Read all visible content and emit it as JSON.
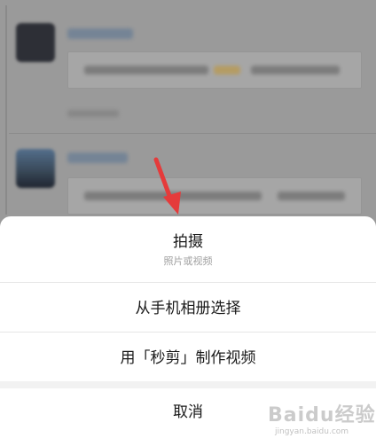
{
  "action_sheet": {
    "capture_label": "拍摄",
    "capture_hint": "照片或视频",
    "album_label": "从手机相册选择",
    "miaojian_label": "用「秒剪」制作视频",
    "cancel_label": "取消"
  },
  "watermark": {
    "brand": "Baidu经验",
    "url": "jingyan.baidu.com"
  },
  "icons": {
    "annotation": "red-arrow-icon"
  },
  "colors": {
    "overlay": "#9a9a9a",
    "sheet_bg": "#ffffff",
    "arrow": "#e53b3b"
  }
}
